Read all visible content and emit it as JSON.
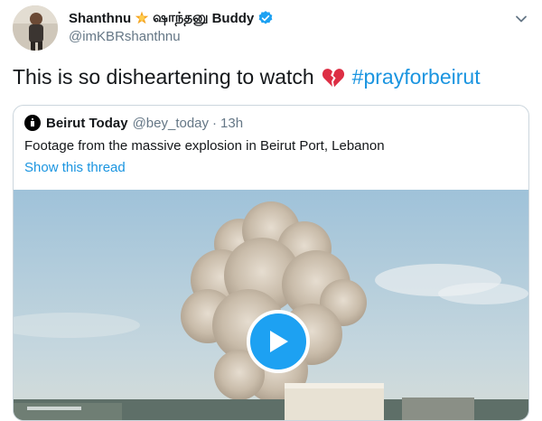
{
  "author": {
    "display_name": "Shanthnu",
    "name_emoji": "star-sun-icon",
    "tamil_name": "ஷாந்தனு",
    "buddy_name": "Buddy",
    "handle": "@imKBRshanthnu",
    "verified": true
  },
  "tweet": {
    "text": "This is so disheartening to watch",
    "emoji": "broken-heart-icon",
    "hashtag": "#prayforbeirut"
  },
  "quoted": {
    "name": "Beirut Today",
    "handle": "@bey_today",
    "separator": "·",
    "time": "13h",
    "text": "Footage from the massive explosion in Beirut Port, Lebanon",
    "show_thread": "Show this thread"
  },
  "media": {
    "type": "video",
    "play_icon": "play-icon"
  },
  "colors": {
    "link_blue": "#1b95e0",
    "verified_blue": "#1da1f2",
    "broken_heart": "#dd2e44",
    "muted": "#657786"
  }
}
